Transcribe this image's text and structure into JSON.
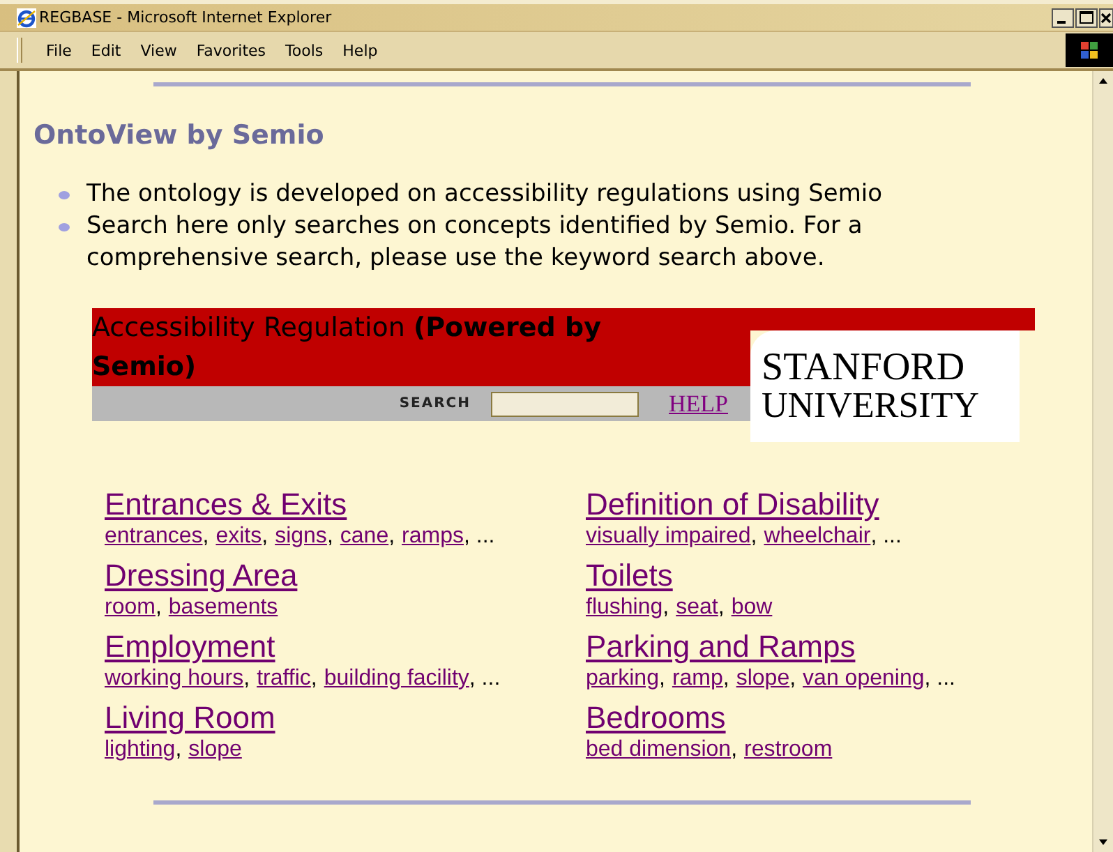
{
  "window": {
    "title": "REGBASE - Microsoft Internet Explorer"
  },
  "menu": [
    {
      "label": "File"
    },
    {
      "label": "Edit"
    },
    {
      "label": "View"
    },
    {
      "label": "Favorites"
    },
    {
      "label": "Tools"
    },
    {
      "label": "Help"
    }
  ],
  "page": {
    "heading": "OntoView by Semio",
    "bullets": [
      "The ontology is developed on accessibility regulations using Semio",
      "Search here only searches on concepts identified by Semio.  For a comprehensive search, please use the keyword search above."
    ],
    "banner": {
      "title": "Accessibility Regulation **(Powered by Semio)**",
      "search_label": "SEARCH",
      "help": "HELP",
      "logo_lines": [
        "STANFORD",
        "UNIVERSITY"
      ]
    },
    "categories": [
      {
        "title": "Entrances & Exits",
        "keywords": [
          {
            "label": "entrances",
            "after": ","
          },
          {
            "label": "exits",
            "after": ","
          },
          {
            "label": "signs",
            "after": ","
          },
          {
            "label": "cane",
            "after": ","
          },
          {
            "label": "ramps",
            "after": ", ..."
          }
        ]
      },
      {
        "title": "Definition of Disability",
        "keywords": [
          {
            "label": "visually impaired",
            "after": ","
          },
          {
            "label": "wheelchair",
            "after": ", ..."
          }
        ]
      },
      {
        "title": "Dressing Area",
        "keywords": [
          {
            "label": "room",
            "after": ","
          },
          {
            "label": "basements"
          }
        ]
      },
      {
        "title": "Toilets",
        "keywords": [
          {
            "label": "flushing",
            "after": ","
          },
          {
            "label": "seat",
            "after": ","
          },
          {
            "label": "bow"
          }
        ]
      },
      {
        "title": "Employment",
        "keywords": [
          {
            "label": "working hours",
            "after": ","
          },
          {
            "label": "traffic",
            "after": ","
          },
          {
            "label": "building facility",
            "after": ", ..."
          }
        ]
      },
      {
        "title": "Parking and Ramps",
        "keywords": [
          {
            "label": "parking",
            "after": ","
          },
          {
            "label": "ramp",
            "after": ","
          },
          {
            "label": "slope",
            "after": ","
          },
          {
            "label": "van opening",
            "after": ", ..."
          }
        ]
      },
      {
        "title": "Living Room",
        "keywords": [
          {
            "label": "lighting",
            "after": ","
          },
          {
            "label": "slope"
          }
        ]
      },
      {
        "title": "Bedrooms",
        "keywords": [
          {
            "label": "bed dimension",
            "after": ","
          },
          {
            "label": "restroom"
          }
        ]
      }
    ]
  }
}
